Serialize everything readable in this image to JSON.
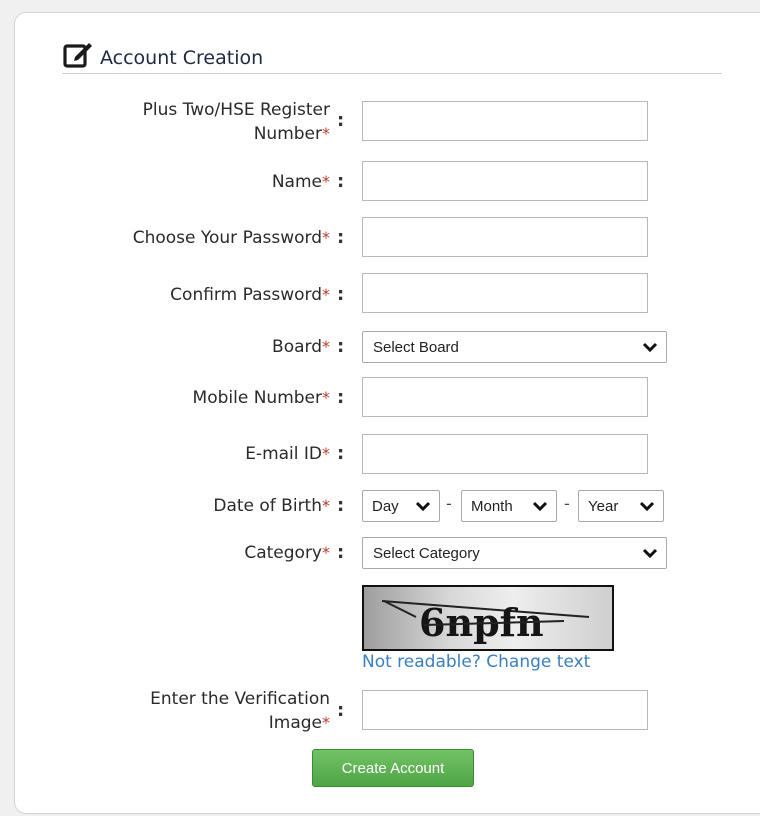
{
  "form": {
    "title": "Account Creation",
    "required_marker": "*",
    "separator": ":",
    "fields": {
      "register_number": {
        "label_line1": "Plus Two/HSE Register",
        "label_line2": "Number",
        "value": ""
      },
      "name": {
        "label": "Name",
        "value": ""
      },
      "password": {
        "label": "Choose Your Password",
        "value": ""
      },
      "confirm_password": {
        "label": "Confirm Password",
        "value": ""
      },
      "board": {
        "label": "Board",
        "selected": "Select Board"
      },
      "mobile": {
        "label": "Mobile Number",
        "value": ""
      },
      "email": {
        "label": "E-mail ID",
        "value": ""
      },
      "dob": {
        "label": "Date of Birth",
        "day": "Day",
        "month": "Month",
        "year": "Year",
        "dash": "-"
      },
      "category": {
        "label": "Category",
        "selected": "Select Category"
      },
      "verification": {
        "label_line1": "Enter the Verification",
        "label_line2": "Image",
        "value": ""
      }
    },
    "captcha": {
      "text": "6npfn",
      "change_link": "Not readable? Change text"
    },
    "submit_label": "Create Account"
  },
  "colors": {
    "required": "#c0392b",
    "link": "#3a7fbf",
    "button": "#5cb34f"
  },
  "icons": {
    "legend": "edit-icon",
    "dropdown": "chevron-down-icon"
  }
}
